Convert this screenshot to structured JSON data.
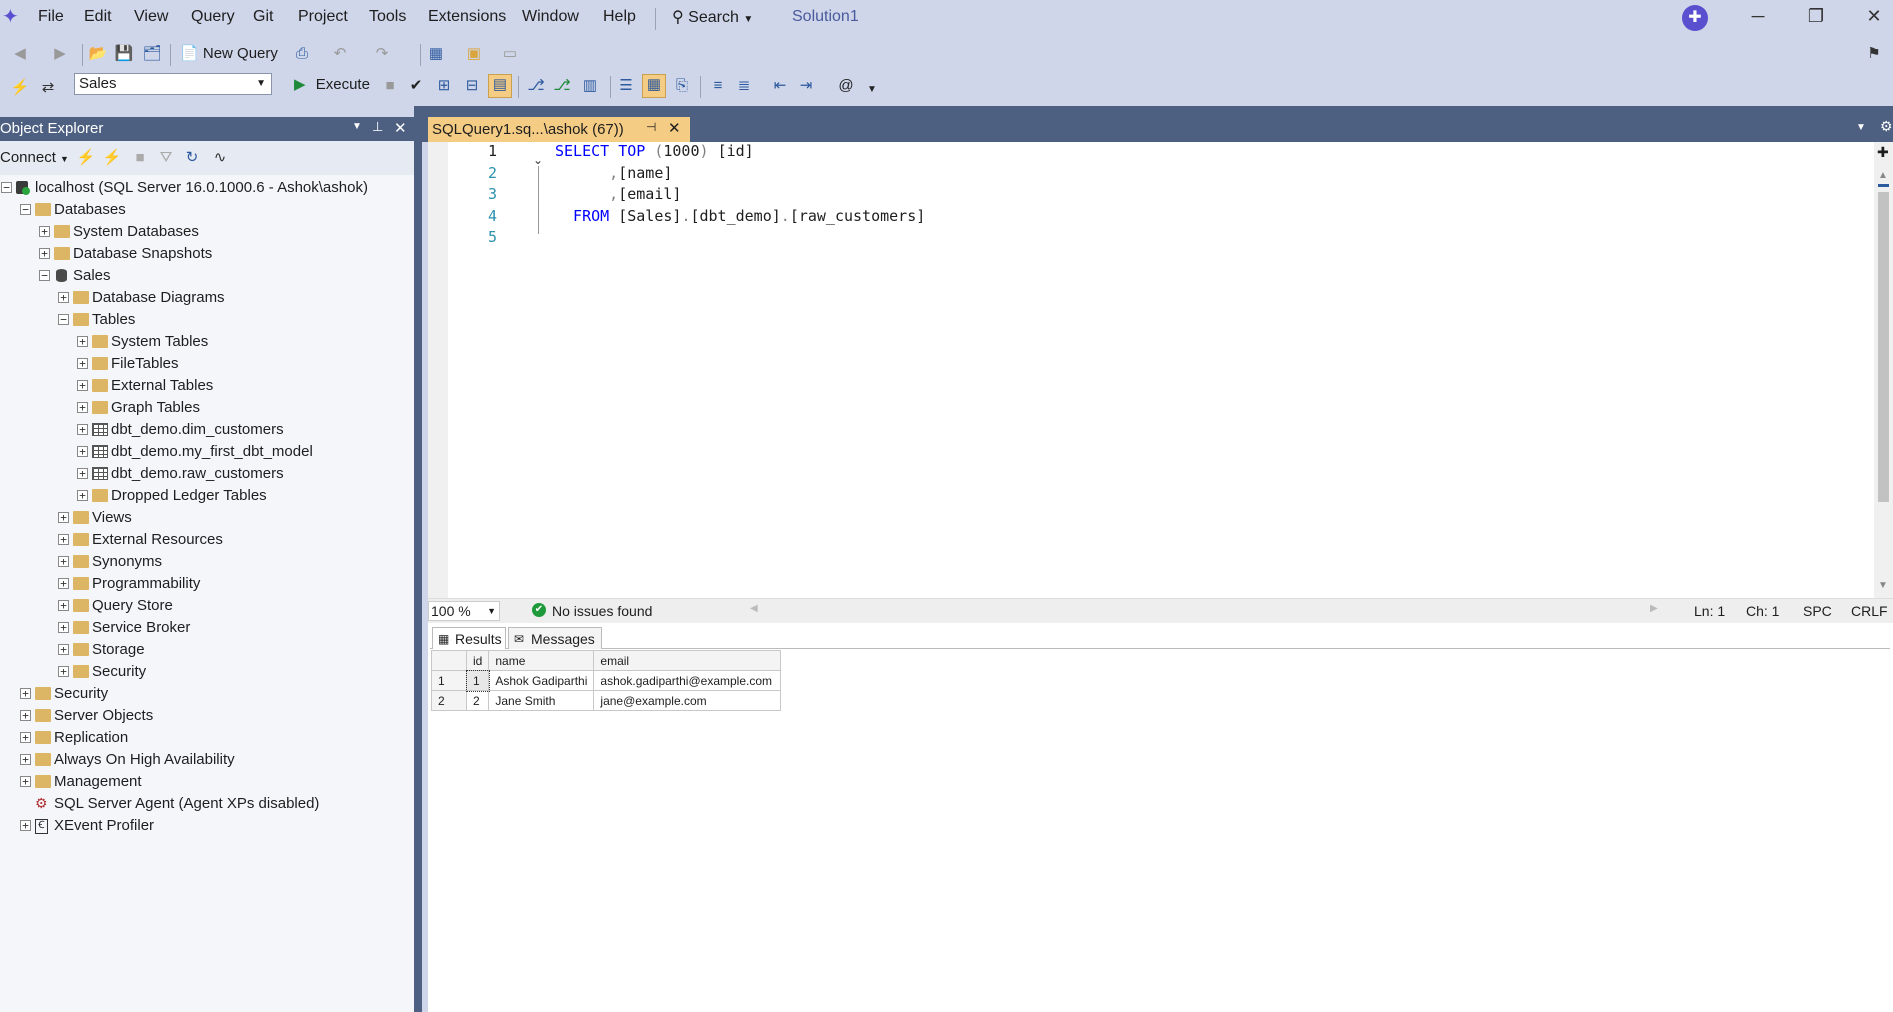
{
  "menu": {
    "items": [
      "File",
      "Edit",
      "View",
      "Query",
      "Git",
      "Project",
      "Tools",
      "Extensions",
      "Window",
      "Help"
    ],
    "search_label": "Search",
    "solution_title": "Solution1"
  },
  "toolbar": {
    "new_query_label": "New Query",
    "database_selected": "Sales",
    "execute_label": "Execute"
  },
  "object_explorer": {
    "title": "Object Explorer",
    "connect_label": "Connect",
    "tree": [
      {
        "label": "localhost (SQL Server 16.0.1000.6 - Ashok\\ashok)",
        "level": 0,
        "icon": "server",
        "expander": "minus"
      },
      {
        "label": "Databases",
        "level": 1,
        "icon": "folder",
        "expander": "minus"
      },
      {
        "label": "System Databases",
        "level": 2,
        "icon": "folder",
        "expander": "plus"
      },
      {
        "label": "Database Snapshots",
        "level": 2,
        "icon": "folder",
        "expander": "plus"
      },
      {
        "label": "Sales",
        "level": 2,
        "icon": "database",
        "expander": "minus"
      },
      {
        "label": "Database Diagrams",
        "level": 3,
        "icon": "folder",
        "expander": "plus"
      },
      {
        "label": "Tables",
        "level": 3,
        "icon": "folder",
        "expander": "minus"
      },
      {
        "label": "System Tables",
        "level": 4,
        "icon": "folder",
        "expander": "plus"
      },
      {
        "label": "FileTables",
        "level": 4,
        "icon": "folder",
        "expander": "plus"
      },
      {
        "label": "External Tables",
        "level": 4,
        "icon": "folder",
        "expander": "plus"
      },
      {
        "label": "Graph Tables",
        "level": 4,
        "icon": "folder",
        "expander": "plus"
      },
      {
        "label": "dbt_demo.dim_customers",
        "level": 4,
        "icon": "table",
        "expander": "plus"
      },
      {
        "label": "dbt_demo.my_first_dbt_model",
        "level": 4,
        "icon": "table",
        "expander": "plus"
      },
      {
        "label": "dbt_demo.raw_customers",
        "level": 4,
        "icon": "table",
        "expander": "plus"
      },
      {
        "label": "Dropped Ledger Tables",
        "level": 4,
        "icon": "folder",
        "expander": "plus"
      },
      {
        "label": "Views",
        "level": 3,
        "icon": "folder",
        "expander": "plus"
      },
      {
        "label": "External Resources",
        "level": 3,
        "icon": "folder",
        "expander": "plus"
      },
      {
        "label": "Synonyms",
        "level": 3,
        "icon": "folder",
        "expander": "plus"
      },
      {
        "label": "Programmability",
        "level": 3,
        "icon": "folder",
        "expander": "plus"
      },
      {
        "label": "Query Store",
        "level": 3,
        "icon": "folder",
        "expander": "plus"
      },
      {
        "label": "Service Broker",
        "level": 3,
        "icon": "folder",
        "expander": "plus"
      },
      {
        "label": "Storage",
        "level": 3,
        "icon": "folder",
        "expander": "plus"
      },
      {
        "label": "Security",
        "level": 3,
        "icon": "folder",
        "expander": "plus"
      },
      {
        "label": "Security",
        "level": 1,
        "icon": "folder",
        "expander": "plus"
      },
      {
        "label": "Server Objects",
        "level": 1,
        "icon": "folder",
        "expander": "plus"
      },
      {
        "label": "Replication",
        "level": 1,
        "icon": "folder",
        "expander": "plus"
      },
      {
        "label": "Always On High Availability",
        "level": 1,
        "icon": "folder",
        "expander": "plus"
      },
      {
        "label": "Management",
        "level": 1,
        "icon": "folder",
        "expander": "plus"
      },
      {
        "label": "SQL Server Agent (Agent XPs disabled)",
        "level": 1,
        "icon": "agent",
        "expander": "none"
      },
      {
        "label": "XEvent Profiler",
        "level": 1,
        "icon": "profiler",
        "expander": "plus"
      }
    ]
  },
  "editor": {
    "tab_label": "SQLQuery1.sq...\\ashok (67))",
    "lines": [
      {
        "num": "1",
        "tokens": [
          {
            "t": "SELECT TOP ",
            "c": "kw"
          },
          {
            "t": "(",
            "c": "gr"
          },
          {
            "t": "1000",
            "c": "id"
          },
          {
            "t": ") ",
            "c": "gr"
          },
          {
            "t": "[id]",
            "c": "id"
          }
        ]
      },
      {
        "num": "2",
        "tokens": [
          {
            "t": "      ,",
            "c": "gr"
          },
          {
            "t": "[name]",
            "c": "id"
          }
        ]
      },
      {
        "num": "3",
        "tokens": [
          {
            "t": "      ,",
            "c": "gr"
          },
          {
            "t": "[email]",
            "c": "id"
          }
        ]
      },
      {
        "num": "4",
        "tokens": [
          {
            "t": "  FROM ",
            "c": "kw"
          },
          {
            "t": "[Sales]",
            "c": "id"
          },
          {
            "t": ".",
            "c": "gr"
          },
          {
            "t": "[dbt_demo]",
            "c": "id"
          },
          {
            "t": ".",
            "c": "gr"
          },
          {
            "t": "[raw_customers]",
            "c": "id"
          }
        ]
      },
      {
        "num": "5",
        "tokens": []
      }
    ],
    "zoom": "100 %",
    "issues_text": "No issues found",
    "ln": "Ln: 1",
    "ch": "Ch: 1",
    "spc": "SPC",
    "crlf": "CRLF"
  },
  "results": {
    "tabs": [
      "Results",
      "Messages"
    ],
    "columns": [
      "id",
      "name",
      "email"
    ],
    "rows": [
      {
        "row": "1",
        "id": "1",
        "name": "Ashok Gadiparthi",
        "email": "ashok.gadiparthi@example.com"
      },
      {
        "row": "2",
        "id": "2",
        "name": "Jane Smith",
        "email": "jane@example.com"
      }
    ]
  },
  "colors": {
    "chrome": "#cfd6e9",
    "panel_header": "#4d6082",
    "active_tab": "#f5cc84",
    "keyword": "#0000ff",
    "line_number": "#2b91af"
  }
}
